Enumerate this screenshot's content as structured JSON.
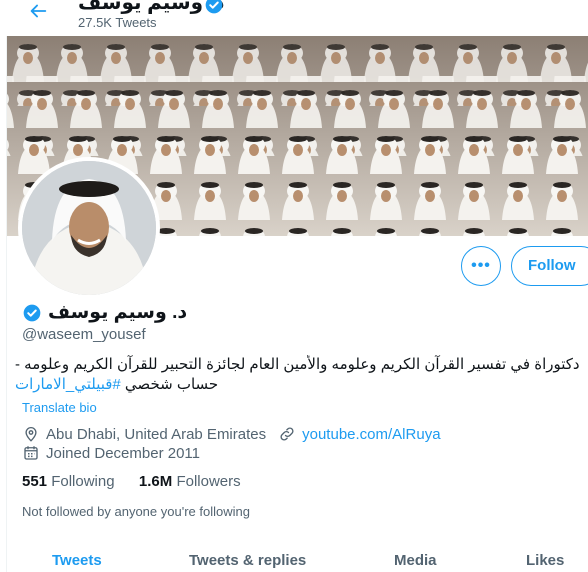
{
  "header": {
    "name": "د. وسيم يوسف",
    "tweet_count": "27.5K Tweets"
  },
  "profile": {
    "display_name": "د. وسيم يوسف",
    "handle": "@waseem_yousef",
    "bio_line1": "دكتوراة في تفسير القرآن الكريم وعلومه والأمين العام لجائزة التحبير للقرآن الكريم وعلومه -",
    "bio_line2_text": "حساب شخصي ",
    "bio_hashtag": "#قبيلتي_الامارات",
    "translate_label": "Translate bio",
    "location": "Abu Dhabi, United Arab Emirates",
    "website": "youtube.com/AlRuya",
    "joined": "Joined December 2011",
    "following_count": "551",
    "following_label": "Following",
    "followers_count": "1.6M",
    "followers_label": "Followers",
    "not_followed": "Not followed by anyone you're following"
  },
  "actions": {
    "more_label": "•••",
    "follow_label": "Follow"
  },
  "tabs": [
    {
      "label": "Tweets",
      "active": true
    },
    {
      "label": "Tweets & replies",
      "active": false
    },
    {
      "label": "Media",
      "active": false
    },
    {
      "label": "Likes",
      "active": false
    }
  ],
  "colors": {
    "accent": "#1d9bf0",
    "secondary_text": "#536471",
    "primary_text": "#0f1419"
  },
  "icons": {
    "back": "back-arrow-icon",
    "verified": "verified-badge-icon",
    "location": "location-pin-icon",
    "link": "link-icon",
    "calendar": "calendar-icon"
  }
}
